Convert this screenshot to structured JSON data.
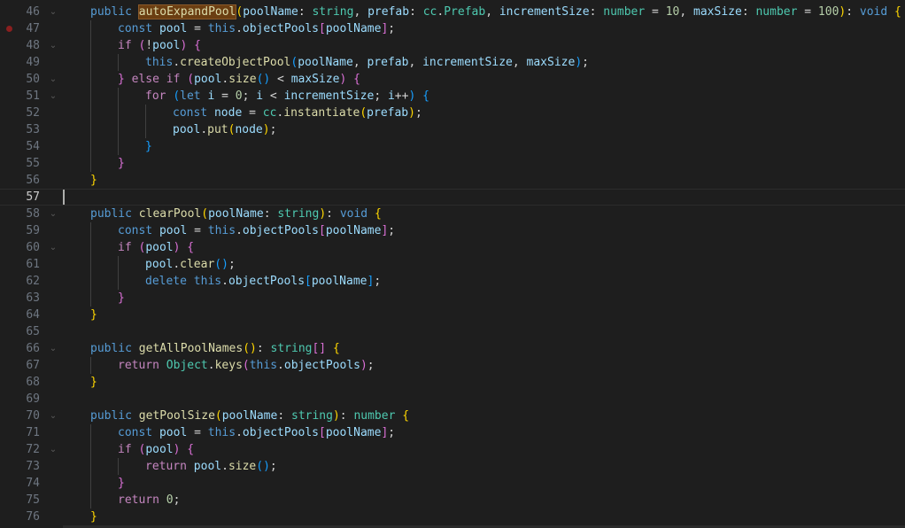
{
  "colors": {
    "background": "#1e1e1e",
    "line_number": "#6e7681",
    "active_line_number": "#cccccc",
    "breakpoint": "#8a1f1f",
    "keyword": "#569cd6",
    "control_keyword": "#c586c0",
    "function": "#dcdcaa",
    "variable": "#9cdcfe",
    "type": "#4ec9b0",
    "number": "#b5cea8",
    "bracket_level_1": "#ffd700",
    "bracket_level_2": "#da70d6",
    "bracket_level_3": "#179fff",
    "search_highlight": "#6b3e12"
  },
  "editor": {
    "active_line": 57,
    "lines": [
      {
        "n": 46,
        "fold": true,
        "bp": false,
        "indent": 1,
        "tokens": [
          [
            "keyword",
            "public "
          ],
          [
            "hl",
            "autoExpandPool"
          ],
          [
            "b1",
            "("
          ],
          [
            "var",
            "poolName"
          ],
          [
            "plain",
            ": "
          ],
          [
            "type",
            "string"
          ],
          [
            "plain",
            ", "
          ],
          [
            "var",
            "prefab"
          ],
          [
            "plain",
            ": "
          ],
          [
            "type",
            "cc"
          ],
          [
            "plain",
            "."
          ],
          [
            "type",
            "Prefab"
          ],
          [
            "plain",
            ", "
          ],
          [
            "var",
            "incrementSize"
          ],
          [
            "plain",
            ": "
          ],
          [
            "type",
            "number"
          ],
          [
            "plain",
            " = "
          ],
          [
            "num",
            "10"
          ],
          [
            "plain",
            ", "
          ],
          [
            "var",
            "maxSize"
          ],
          [
            "plain",
            ": "
          ],
          [
            "type",
            "number"
          ],
          [
            "plain",
            " = "
          ],
          [
            "num",
            "100"
          ],
          [
            "b1",
            ")"
          ],
          [
            "plain",
            ": "
          ],
          [
            "keyword",
            "void "
          ],
          [
            "b1",
            "{"
          ]
        ]
      },
      {
        "n": 47,
        "fold": false,
        "bp": true,
        "indent": 2,
        "tokens": [
          [
            "keyword",
            "const "
          ],
          [
            "var",
            "pool"
          ],
          [
            "plain",
            " = "
          ],
          [
            "keyword",
            "this"
          ],
          [
            "plain",
            "."
          ],
          [
            "var",
            "objectPools"
          ],
          [
            "b2",
            "["
          ],
          [
            "var",
            "poolName"
          ],
          [
            "b2",
            "]"
          ],
          [
            "plain",
            ";"
          ]
        ]
      },
      {
        "n": 48,
        "fold": true,
        "bp": false,
        "indent": 2,
        "tokens": [
          [
            "control",
            "if "
          ],
          [
            "b2",
            "("
          ],
          [
            "plain",
            "!"
          ],
          [
            "var",
            "pool"
          ],
          [
            "b2",
            ")"
          ],
          [
            "plain",
            " "
          ],
          [
            "b2",
            "{"
          ]
        ]
      },
      {
        "n": 49,
        "fold": false,
        "bp": false,
        "indent": 3,
        "tokens": [
          [
            "keyword",
            "this"
          ],
          [
            "plain",
            "."
          ],
          [
            "fn",
            "createObjectPool"
          ],
          [
            "b3",
            "("
          ],
          [
            "var",
            "poolName"
          ],
          [
            "plain",
            ", "
          ],
          [
            "var",
            "prefab"
          ],
          [
            "plain",
            ", "
          ],
          [
            "var",
            "incrementSize"
          ],
          [
            "plain",
            ", "
          ],
          [
            "var",
            "maxSize"
          ],
          [
            "b3",
            ")"
          ],
          [
            "plain",
            ";"
          ]
        ]
      },
      {
        "n": 50,
        "fold": true,
        "bp": false,
        "indent": 2,
        "tokens": [
          [
            "b2",
            "}"
          ],
          [
            "plain",
            " "
          ],
          [
            "control",
            "else if "
          ],
          [
            "b2",
            "("
          ],
          [
            "var",
            "pool"
          ],
          [
            "plain",
            "."
          ],
          [
            "fn",
            "size"
          ],
          [
            "b3",
            "()"
          ],
          [
            "plain",
            " < "
          ],
          [
            "var",
            "maxSize"
          ],
          [
            "b2",
            ")"
          ],
          [
            "plain",
            " "
          ],
          [
            "b2",
            "{"
          ]
        ]
      },
      {
        "n": 51,
        "fold": true,
        "bp": false,
        "indent": 3,
        "tokens": [
          [
            "control",
            "for "
          ],
          [
            "b3",
            "("
          ],
          [
            "keyword",
            "let "
          ],
          [
            "var",
            "i"
          ],
          [
            "plain",
            " = "
          ],
          [
            "num",
            "0"
          ],
          [
            "plain",
            "; "
          ],
          [
            "var",
            "i"
          ],
          [
            "plain",
            " < "
          ],
          [
            "var",
            "incrementSize"
          ],
          [
            "plain",
            "; "
          ],
          [
            "var",
            "i"
          ],
          [
            "plain",
            "++"
          ],
          [
            "b3",
            ")"
          ],
          [
            "plain",
            " "
          ],
          [
            "b3",
            "{"
          ]
        ]
      },
      {
        "n": 52,
        "fold": false,
        "bp": false,
        "indent": 4,
        "tokens": [
          [
            "keyword",
            "const "
          ],
          [
            "var",
            "node"
          ],
          [
            "plain",
            " = "
          ],
          [
            "type",
            "cc"
          ],
          [
            "plain",
            "."
          ],
          [
            "fn",
            "instantiate"
          ],
          [
            "b1",
            "("
          ],
          [
            "var",
            "prefab"
          ],
          [
            "b1",
            ")"
          ],
          [
            "plain",
            ";"
          ]
        ]
      },
      {
        "n": 53,
        "fold": false,
        "bp": false,
        "indent": 4,
        "tokens": [
          [
            "var",
            "pool"
          ],
          [
            "plain",
            "."
          ],
          [
            "fn",
            "put"
          ],
          [
            "b1",
            "("
          ],
          [
            "var",
            "node"
          ],
          [
            "b1",
            ")"
          ],
          [
            "plain",
            ";"
          ]
        ]
      },
      {
        "n": 54,
        "fold": false,
        "bp": false,
        "indent": 3,
        "tokens": [
          [
            "b3",
            "}"
          ]
        ]
      },
      {
        "n": 55,
        "fold": false,
        "bp": false,
        "indent": 2,
        "tokens": [
          [
            "b2",
            "}"
          ]
        ]
      },
      {
        "n": 56,
        "fold": false,
        "bp": false,
        "indent": 1,
        "tokens": [
          [
            "b1",
            "}"
          ]
        ]
      },
      {
        "n": 57,
        "fold": false,
        "bp": false,
        "indent": 0,
        "tokens": []
      },
      {
        "n": 58,
        "fold": true,
        "bp": false,
        "indent": 1,
        "tokens": [
          [
            "keyword",
            "public "
          ],
          [
            "fn",
            "clearPool"
          ],
          [
            "b1",
            "("
          ],
          [
            "var",
            "poolName"
          ],
          [
            "plain",
            ": "
          ],
          [
            "type",
            "string"
          ],
          [
            "b1",
            ")"
          ],
          [
            "plain",
            ": "
          ],
          [
            "keyword",
            "void "
          ],
          [
            "b1",
            "{"
          ]
        ]
      },
      {
        "n": 59,
        "fold": false,
        "bp": false,
        "indent": 2,
        "tokens": [
          [
            "keyword",
            "const "
          ],
          [
            "var",
            "pool"
          ],
          [
            "plain",
            " = "
          ],
          [
            "keyword",
            "this"
          ],
          [
            "plain",
            "."
          ],
          [
            "var",
            "objectPools"
          ],
          [
            "b2",
            "["
          ],
          [
            "var",
            "poolName"
          ],
          [
            "b2",
            "]"
          ],
          [
            "plain",
            ";"
          ]
        ]
      },
      {
        "n": 60,
        "fold": true,
        "bp": false,
        "indent": 2,
        "tokens": [
          [
            "control",
            "if "
          ],
          [
            "b2",
            "("
          ],
          [
            "var",
            "pool"
          ],
          [
            "b2",
            ")"
          ],
          [
            "plain",
            " "
          ],
          [
            "b2",
            "{"
          ]
        ]
      },
      {
        "n": 61,
        "fold": false,
        "bp": false,
        "indent": 3,
        "tokens": [
          [
            "var",
            "pool"
          ],
          [
            "plain",
            "."
          ],
          [
            "fn",
            "clear"
          ],
          [
            "b3",
            "()"
          ],
          [
            "plain",
            ";"
          ]
        ]
      },
      {
        "n": 62,
        "fold": false,
        "bp": false,
        "indent": 3,
        "tokens": [
          [
            "keyword",
            "delete "
          ],
          [
            "keyword",
            "this"
          ],
          [
            "plain",
            "."
          ],
          [
            "var",
            "objectPools"
          ],
          [
            "b3",
            "["
          ],
          [
            "var",
            "poolName"
          ],
          [
            "b3",
            "]"
          ],
          [
            "plain",
            ";"
          ]
        ]
      },
      {
        "n": 63,
        "fold": false,
        "bp": false,
        "indent": 2,
        "tokens": [
          [
            "b2",
            "}"
          ]
        ]
      },
      {
        "n": 64,
        "fold": false,
        "bp": false,
        "indent": 1,
        "tokens": [
          [
            "b1",
            "}"
          ]
        ]
      },
      {
        "n": 65,
        "fold": false,
        "bp": false,
        "indent": 0,
        "tokens": []
      },
      {
        "n": 66,
        "fold": true,
        "bp": false,
        "indent": 1,
        "tokens": [
          [
            "keyword",
            "public "
          ],
          [
            "fn",
            "getAllPoolNames"
          ],
          [
            "b1",
            "()"
          ],
          [
            "plain",
            ": "
          ],
          [
            "type",
            "string"
          ],
          [
            "b2",
            "[]"
          ],
          [
            "plain",
            " "
          ],
          [
            "b1",
            "{"
          ]
        ]
      },
      {
        "n": 67,
        "fold": false,
        "bp": false,
        "indent": 2,
        "tokens": [
          [
            "control",
            "return "
          ],
          [
            "type",
            "Object"
          ],
          [
            "plain",
            "."
          ],
          [
            "fn",
            "keys"
          ],
          [
            "b2",
            "("
          ],
          [
            "keyword",
            "this"
          ],
          [
            "plain",
            "."
          ],
          [
            "var",
            "objectPools"
          ],
          [
            "b2",
            ")"
          ],
          [
            "plain",
            ";"
          ]
        ]
      },
      {
        "n": 68,
        "fold": false,
        "bp": false,
        "indent": 1,
        "tokens": [
          [
            "b1",
            "}"
          ]
        ]
      },
      {
        "n": 69,
        "fold": false,
        "bp": false,
        "indent": 0,
        "tokens": []
      },
      {
        "n": 70,
        "fold": true,
        "bp": false,
        "indent": 1,
        "tokens": [
          [
            "keyword",
            "public "
          ],
          [
            "fn",
            "getPoolSize"
          ],
          [
            "b1",
            "("
          ],
          [
            "var",
            "poolName"
          ],
          [
            "plain",
            ": "
          ],
          [
            "type",
            "string"
          ],
          [
            "b1",
            ")"
          ],
          [
            "plain",
            ": "
          ],
          [
            "type",
            "number "
          ],
          [
            "b1",
            "{"
          ]
        ]
      },
      {
        "n": 71,
        "fold": false,
        "bp": false,
        "indent": 2,
        "tokens": [
          [
            "keyword",
            "const "
          ],
          [
            "var",
            "pool"
          ],
          [
            "plain",
            " = "
          ],
          [
            "keyword",
            "this"
          ],
          [
            "plain",
            "."
          ],
          [
            "var",
            "objectPools"
          ],
          [
            "b2",
            "["
          ],
          [
            "var",
            "poolName"
          ],
          [
            "b2",
            "]"
          ],
          [
            "plain",
            ";"
          ]
        ]
      },
      {
        "n": 72,
        "fold": true,
        "bp": false,
        "indent": 2,
        "tokens": [
          [
            "control",
            "if "
          ],
          [
            "b2",
            "("
          ],
          [
            "var",
            "pool"
          ],
          [
            "b2",
            ")"
          ],
          [
            "plain",
            " "
          ],
          [
            "b2",
            "{"
          ]
        ]
      },
      {
        "n": 73,
        "fold": false,
        "bp": false,
        "indent": 3,
        "tokens": [
          [
            "control",
            "return "
          ],
          [
            "var",
            "pool"
          ],
          [
            "plain",
            "."
          ],
          [
            "fn",
            "size"
          ],
          [
            "b3",
            "()"
          ],
          [
            "plain",
            ";"
          ]
        ]
      },
      {
        "n": 74,
        "fold": false,
        "bp": false,
        "indent": 2,
        "tokens": [
          [
            "b2",
            "}"
          ]
        ]
      },
      {
        "n": 75,
        "fold": false,
        "bp": false,
        "indent": 2,
        "tokens": [
          [
            "control",
            "return "
          ],
          [
            "num",
            "0"
          ],
          [
            "plain",
            ";"
          ]
        ]
      },
      {
        "n": 76,
        "fold": false,
        "bp": false,
        "indent": 1,
        "tokens": [
          [
            "b1",
            "}"
          ]
        ]
      }
    ]
  }
}
